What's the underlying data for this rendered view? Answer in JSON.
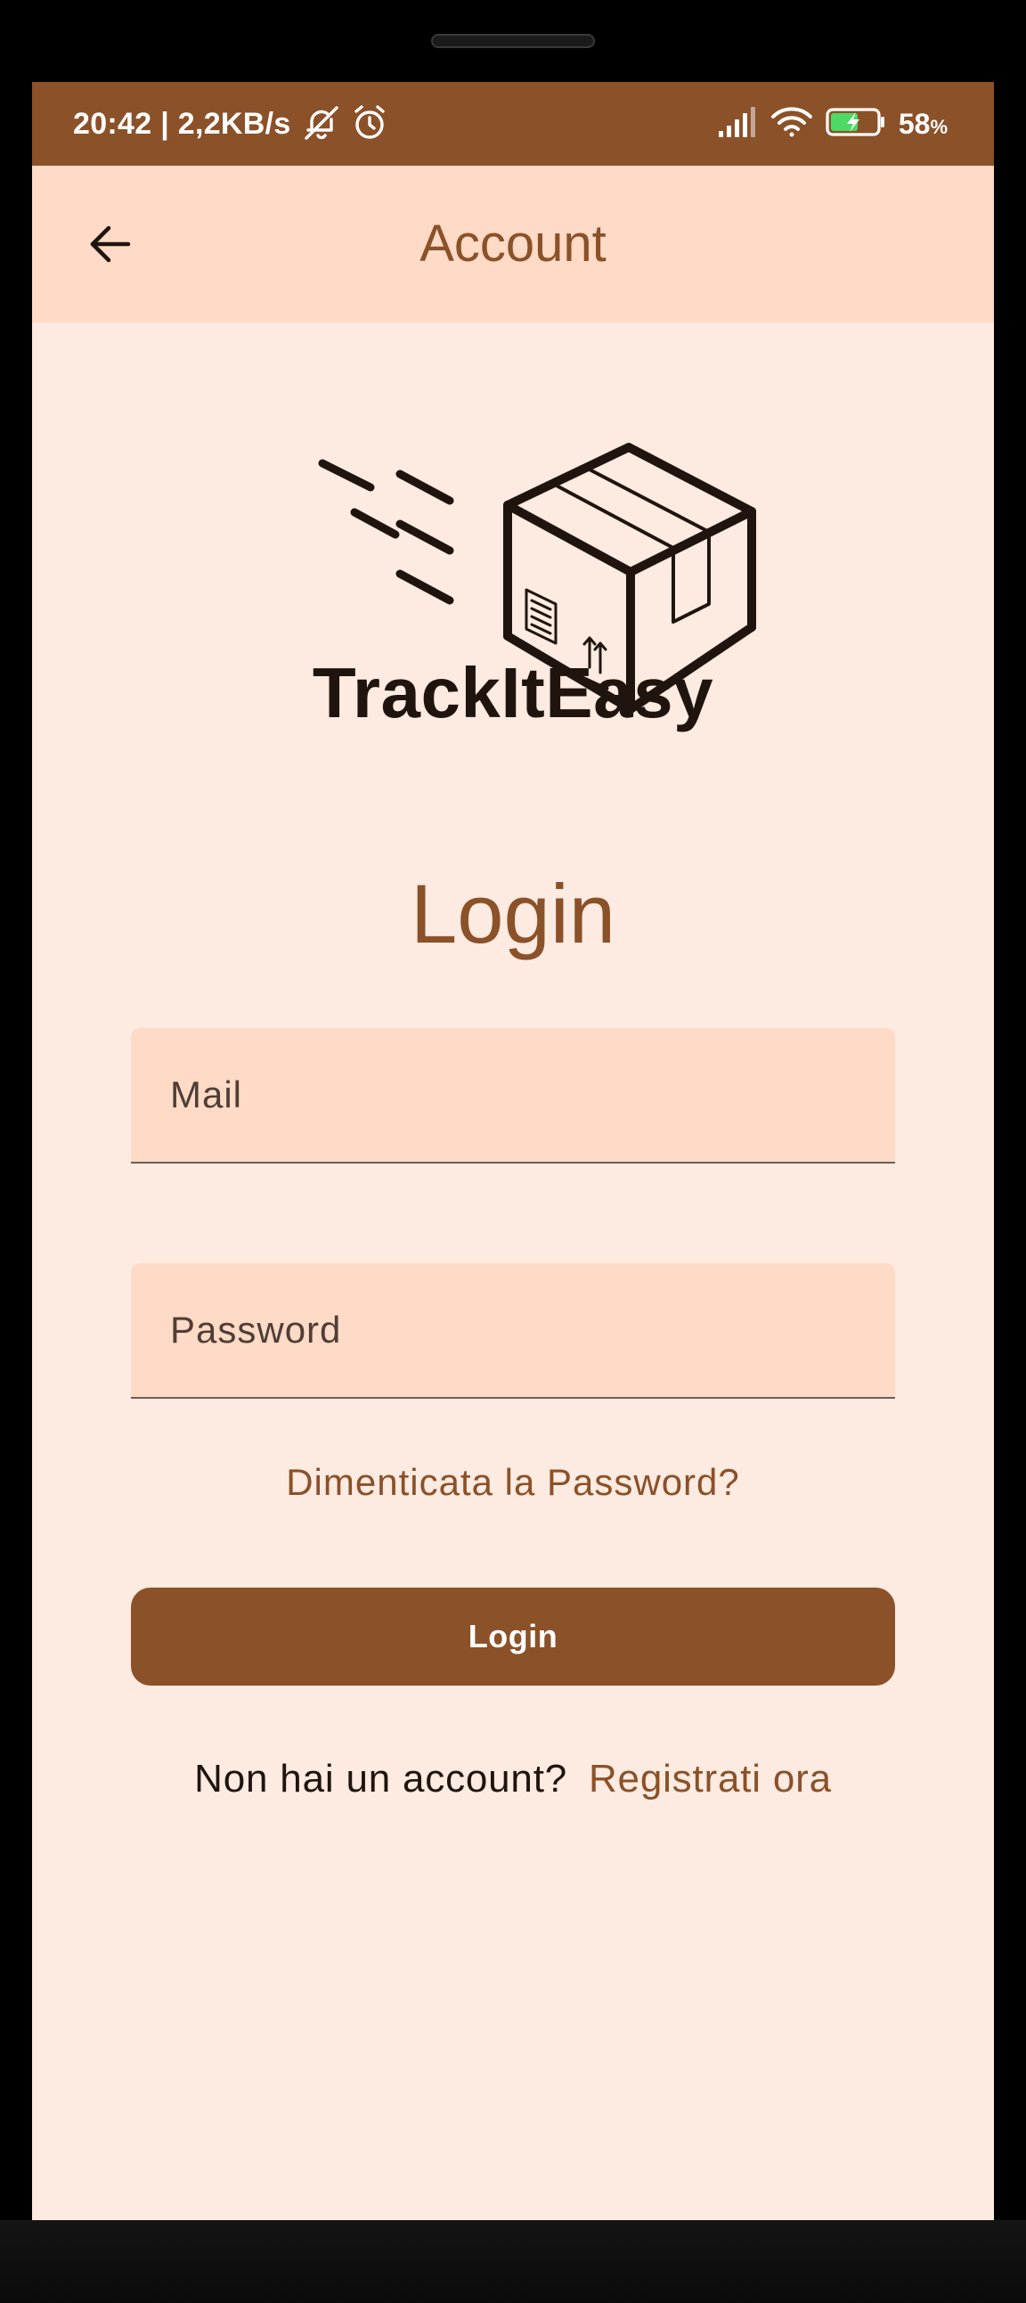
{
  "status_bar": {
    "time_speed": "20:42 | 2,2KB/s",
    "battery_percent": "58",
    "battery_unit": "%",
    "icons": [
      "bell-off-icon",
      "alarm-icon",
      "signal-icon",
      "wifi-icon",
      "battery-charging-icon"
    ]
  },
  "app_bar": {
    "title": "Account",
    "back_icon": "arrow-left-icon"
  },
  "brand": {
    "logo": "package-box-icon",
    "name": "TrackItEasy"
  },
  "login": {
    "title": "Login",
    "mail_placeholder": "Mail",
    "mail_value": "",
    "password_placeholder": "Password",
    "password_value": "",
    "forgot_password": "Dimenticata la Password?",
    "submit_label": "Login",
    "no_account_prompt": "Non hai un account?",
    "register_link": "Registrati ora"
  },
  "colors": {
    "primary": "#8b5129",
    "app_bar_bg": "#ffdac6",
    "screen_bg": "#fdebe1",
    "field_bg": "#ffdac6",
    "text_dark": "#20150e"
  }
}
